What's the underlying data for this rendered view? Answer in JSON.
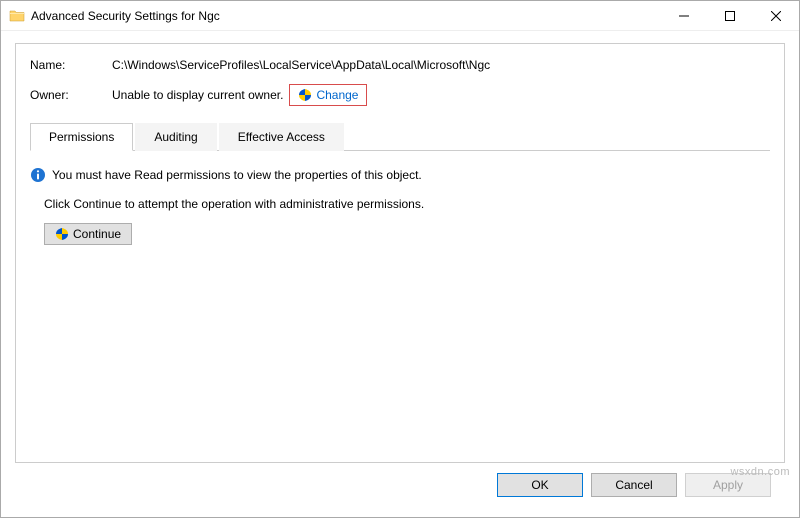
{
  "window": {
    "title": "Advanced Security Settings for Ngc"
  },
  "fields": {
    "name_label": "Name:",
    "name_value": "C:\\Windows\\ServiceProfiles\\LocalService\\AppData\\Local\\Microsoft\\Ngc",
    "owner_label": "Owner:",
    "owner_value": "Unable to display current owner.",
    "change_link": "Change"
  },
  "tabs": {
    "permissions": "Permissions",
    "auditing": "Auditing",
    "effective": "Effective Access"
  },
  "body": {
    "info_text": "You must have Read permissions to view the properties of this object.",
    "hint_text": "Click Continue to attempt the operation with administrative permissions.",
    "continue_label": "Continue"
  },
  "footer": {
    "ok": "OK",
    "cancel": "Cancel",
    "apply": "Apply"
  },
  "watermark": "wsxdn.com"
}
